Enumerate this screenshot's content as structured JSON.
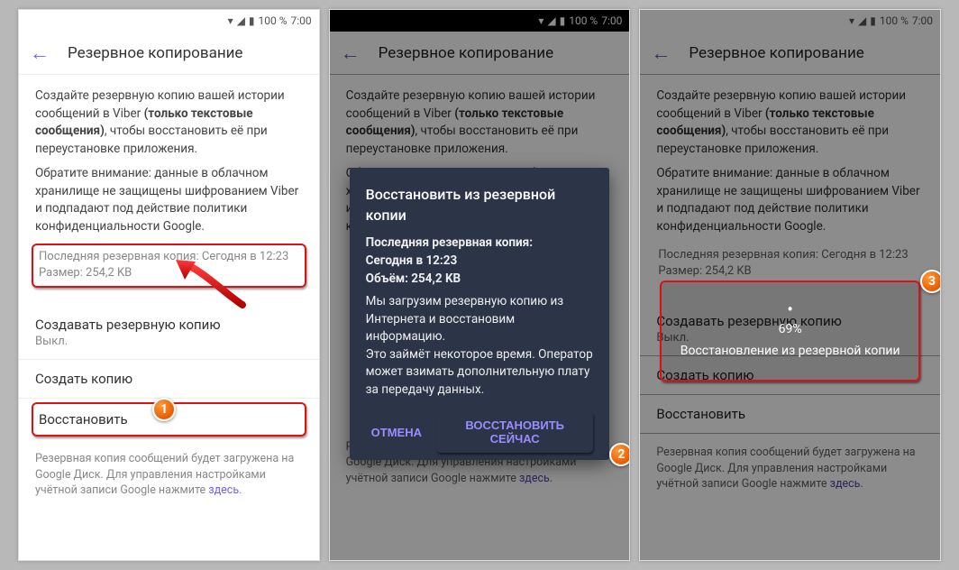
{
  "status": {
    "battery_text": "100 %",
    "time": "7:00"
  },
  "appbar": {
    "title": "Резервное копирование"
  },
  "intro": {
    "part1": "Создайте резервную копию вашей истории сообщений в Viber ",
    "bold": "(только текстовые сообщения)",
    "part2": ", чтобы восстановить её при переустановке приложения."
  },
  "note": "Обратите внимание: данные в облачном хранилище не защищены шифрованием Viber и подпадают под действие политики конфиденциальности Google.",
  "last_backup": {
    "line1": "Последняя резервная копия: Сегодня в 12:23",
    "line2": "Размер: 254,2 KB"
  },
  "sections": {
    "auto": {
      "title": "Создавать резервную копию",
      "sub": "Выкл."
    },
    "make": "Создать копию",
    "restore": "Восстановить"
  },
  "footer": {
    "text": "Резервная копия сообщений будет загружена на Google Диск. Для управления настройками учётной записи Google нажмите ",
    "link": "здесь"
  },
  "dialog": {
    "title": "Восстановить из резервной копии",
    "last_label": "Последняя резервная копия:",
    "last_value": "Сегодня в 12:23",
    "size_label": "Объём:",
    "size_value": "254,2 KB",
    "body1": "Мы загрузим резервную копию из Интернета и восстановим информацию.",
    "body2": "Это займёт некоторое время. Оператор может взимать дополнительную плату за передачу данных.",
    "cancel": "ОТМЕНА",
    "confirm": "ВОССТАНОВИТЬ СЕЙЧАС"
  },
  "progress": {
    "percent": "69%",
    "label": "Восстановление из резервной копии"
  },
  "badges": {
    "b1": "1",
    "b2": "2",
    "b3": "3"
  }
}
